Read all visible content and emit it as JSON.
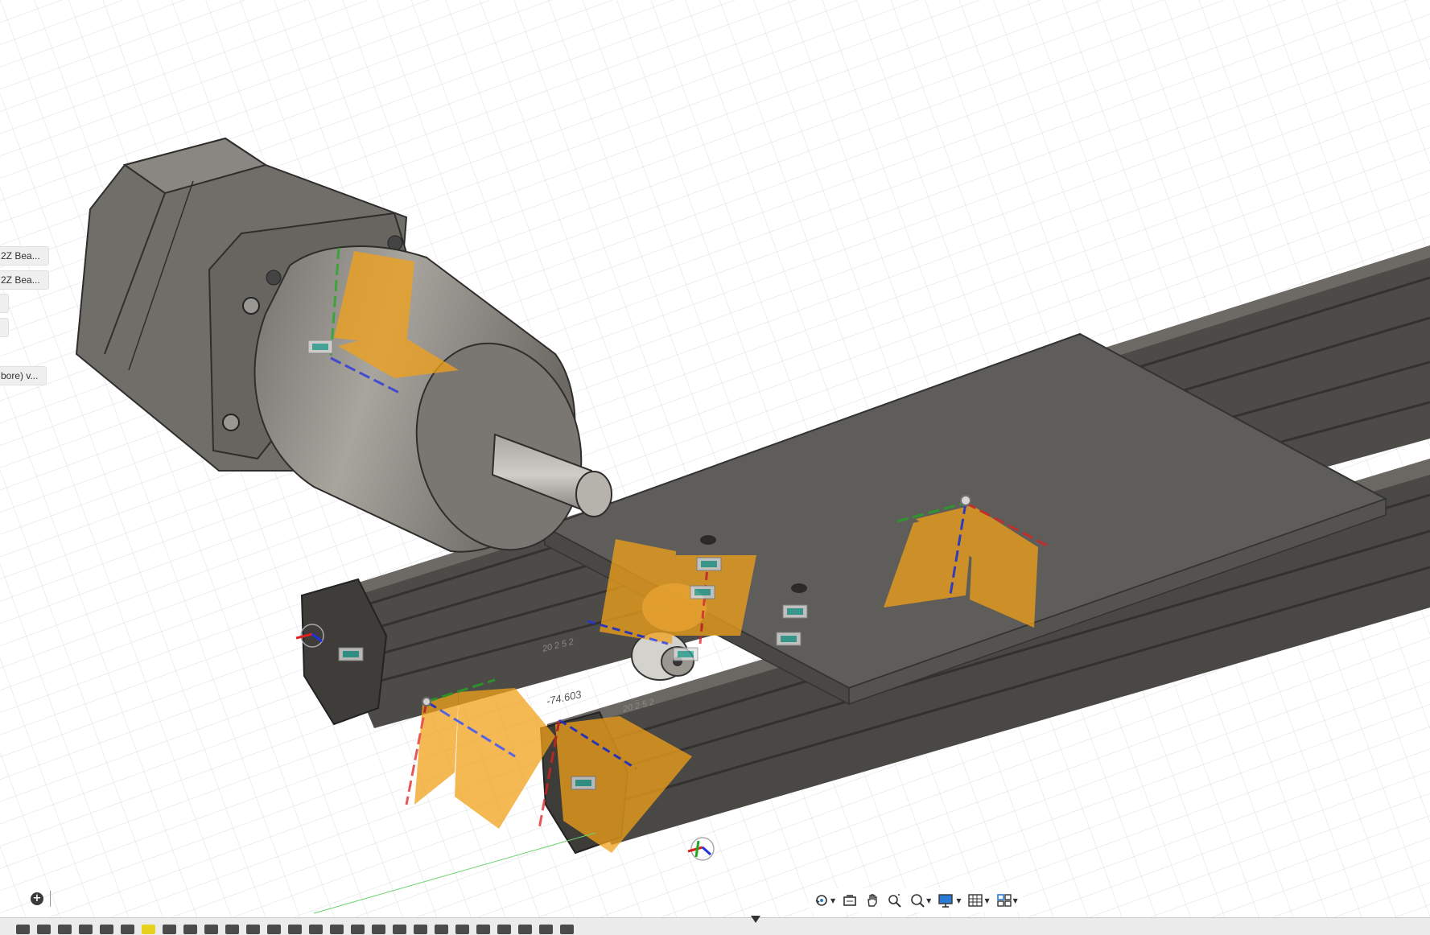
{
  "browser": {
    "items": [
      "2Z Bea...",
      "2Z Bea...",
      "bore) v..."
    ]
  },
  "viewport": {
    "dimension_value": "-74.603",
    "profile_label_1": "20 2 5 2",
    "profile_label_2": "20 2 5 2"
  },
  "navbar": {
    "icons": [
      "orbit-icon",
      "look-at-icon",
      "pan-icon",
      "zoom-icon",
      "zoom-window-icon",
      "display-settings-icon",
      "grid-settings-icon",
      "viewports-icon"
    ]
  },
  "timeline": {
    "feature_count": 27,
    "selected_index": 6
  },
  "colors": {
    "background": "#ffffff",
    "grid": "#d9dde2",
    "metal": "#5c5a55",
    "joint_plane": "#f2a21a",
    "x_axis": "#e02020",
    "y_axis": "#1faa1f",
    "z_axis": "#2030e0"
  }
}
